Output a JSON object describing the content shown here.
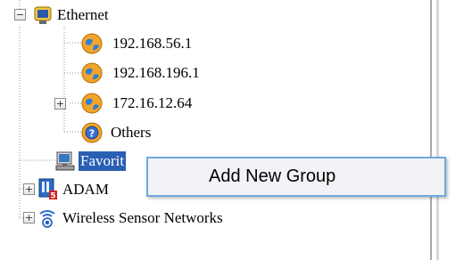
{
  "tree": {
    "ethernet": {
      "label": "Ethernet",
      "expander": "−"
    },
    "ips": [
      {
        "label": "192.168.56.1"
      },
      {
        "label": "192.168.196.1"
      },
      {
        "label": "172.16.12.64",
        "expander": "+"
      }
    ],
    "others": {
      "label": "Others"
    },
    "favorite": {
      "label": "Favorit"
    },
    "adam": {
      "label": "ADAM",
      "expander": "+"
    },
    "wsn": {
      "label": "Wireless Sensor Networks",
      "expander": "+"
    }
  },
  "context_menu": {
    "items": [
      {
        "label": "Add New Group"
      }
    ]
  },
  "icons": {
    "ethernet": "network-adapter-icon",
    "ip": "globe-icon",
    "others": "help-icon",
    "favorite": "computer-icon",
    "adam": "adam-module-icon",
    "wsn": "wireless-icon"
  },
  "colors": {
    "selection": "#2a5fb4",
    "menu_border": "#6fa8dc",
    "menu_bg": "#f1f3f6"
  }
}
